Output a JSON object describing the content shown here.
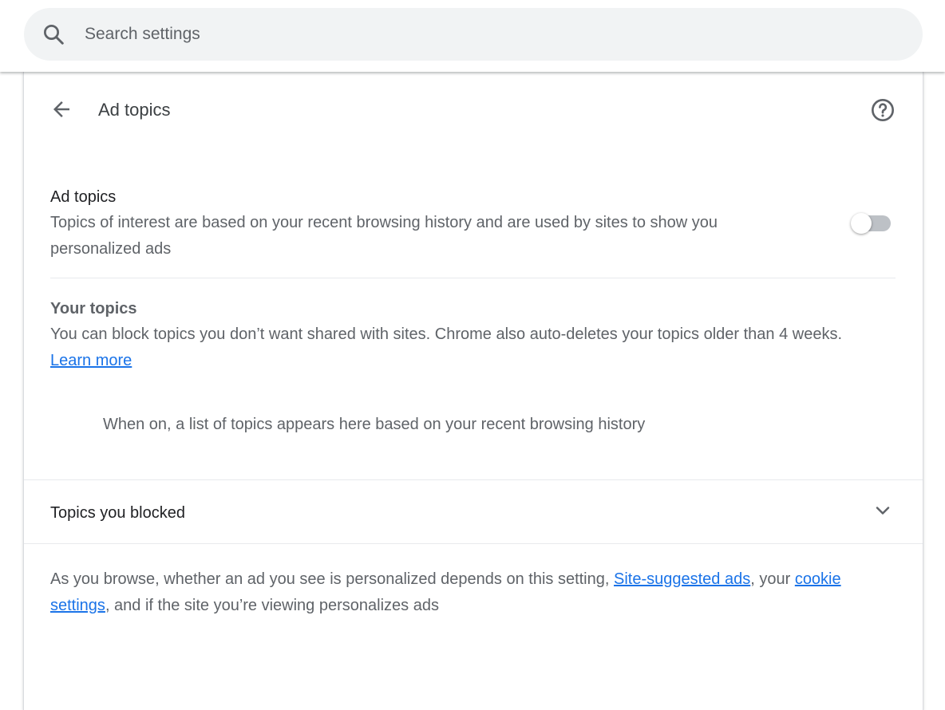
{
  "search": {
    "placeholder": "Search settings"
  },
  "header": {
    "title": "Ad topics"
  },
  "ad_topics": {
    "title": "Ad topics",
    "description": "Topics of interest are based on your recent browsing history and are used by sites to show you personalized ads",
    "toggle_on": false
  },
  "your_topics": {
    "title": "Your topics",
    "description_1": "You can block topics you don’t want shared with sites. Chrome also auto-deletes your topics older than 4 weeks.",
    "learn_more": "Learn more",
    "empty_state": "When on, a list of topics appears here based on your recent browsing history"
  },
  "blocked": {
    "label": "Topics you blocked"
  },
  "footer": {
    "part_1": "As you browse, whether an ad you see is personalized depends on this setting, ",
    "link_1": "Site-suggested ads",
    "part_2": ", your ",
    "link_2": "cookie settings",
    "part_3": ", and if the site you’re viewing personalizes ads"
  },
  "colors": {
    "link": "#1a73e8",
    "toggle_track_off": "#bdc1c6"
  }
}
